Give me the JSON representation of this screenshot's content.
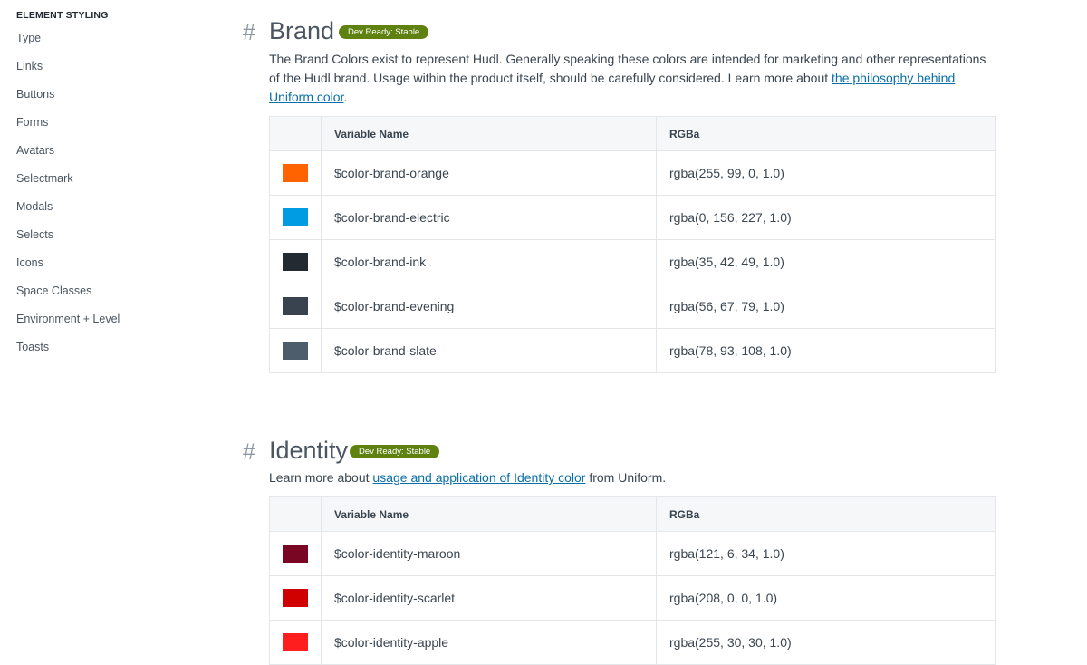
{
  "sidebar": {
    "heading": "ELEMENT STYLING",
    "items": [
      {
        "label": "Type"
      },
      {
        "label": "Links"
      },
      {
        "label": "Buttons"
      },
      {
        "label": "Forms"
      },
      {
        "label": "Avatars"
      },
      {
        "label": "Selectmark"
      },
      {
        "label": "Modals"
      },
      {
        "label": "Selects"
      },
      {
        "label": "Icons"
      },
      {
        "label": "Space Classes"
      },
      {
        "label": "Environment + Level"
      },
      {
        "label": "Toasts"
      }
    ]
  },
  "colors": {
    "badge_bg": "#5f8110",
    "link": "#0a6fa8"
  },
  "brand": {
    "hash": "#",
    "title": "Brand",
    "badge": "Dev Ready: Stable",
    "desc_prefix": "The Brand Colors exist to represent Hudl. Generally speaking these colors are intended for marketing and other representations of the Hudl brand. Usage within the product itself, should be carefully considered. Learn more about ",
    "desc_link": "the philosophy behind Uniform color",
    "desc_suffix": ".",
    "table": {
      "headers": [
        "",
        "Variable Name",
        "RGBa"
      ],
      "rows": [
        {
          "color": "#ff6300",
          "name": "$color-brand-orange",
          "rgba": "rgba(255, 99, 0, 1.0)"
        },
        {
          "color": "#009ce3",
          "name": "$color-brand-electric",
          "rgba": "rgba(0, 156, 227, 1.0)"
        },
        {
          "color": "#232a31",
          "name": "$color-brand-ink",
          "rgba": "rgba(35, 42, 49, 1.0)"
        },
        {
          "color": "#38434f",
          "name": "$color-brand-evening",
          "rgba": "rgba(56, 67, 79, 1.0)"
        },
        {
          "color": "#4e5d6c",
          "name": "$color-brand-slate",
          "rgba": "rgba(78, 93, 108, 1.0)"
        }
      ]
    }
  },
  "identity": {
    "hash": "#",
    "title": "Identity",
    "badge": "Dev Ready: Stable",
    "desc_prefix": "Learn more about ",
    "desc_link": "usage and application of Identity color",
    "desc_suffix": " from Uniform.",
    "table": {
      "headers": [
        "",
        "Variable Name",
        "RGBa"
      ],
      "rows": [
        {
          "color": "#790622",
          "name": "$color-identity-maroon",
          "rgba": "rgba(121, 6, 34, 1.0)"
        },
        {
          "color": "#d00000",
          "name": "$color-identity-scarlet",
          "rgba": "rgba(208, 0, 0, 1.0)"
        },
        {
          "color": "#ff1e1e",
          "name": "$color-identity-apple",
          "rgba": "rgba(255, 30, 30, 1.0)"
        }
      ]
    }
  }
}
